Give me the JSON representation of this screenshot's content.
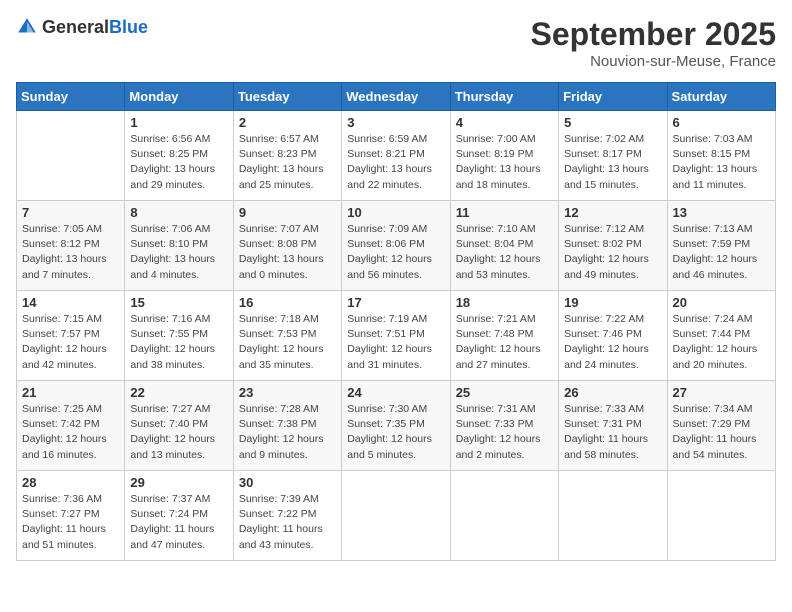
{
  "header": {
    "logo_general": "General",
    "logo_blue": "Blue",
    "month": "September 2025",
    "location": "Nouvion-sur-Meuse, France"
  },
  "days_of_week": [
    "Sunday",
    "Monday",
    "Tuesday",
    "Wednesday",
    "Thursday",
    "Friday",
    "Saturday"
  ],
  "weeks": [
    [
      {
        "day": "",
        "info": ""
      },
      {
        "day": "1",
        "info": "Sunrise: 6:56 AM\nSunset: 8:25 PM\nDaylight: 13 hours\nand 29 minutes."
      },
      {
        "day": "2",
        "info": "Sunrise: 6:57 AM\nSunset: 8:23 PM\nDaylight: 13 hours\nand 25 minutes."
      },
      {
        "day": "3",
        "info": "Sunrise: 6:59 AM\nSunset: 8:21 PM\nDaylight: 13 hours\nand 22 minutes."
      },
      {
        "day": "4",
        "info": "Sunrise: 7:00 AM\nSunset: 8:19 PM\nDaylight: 13 hours\nand 18 minutes."
      },
      {
        "day": "5",
        "info": "Sunrise: 7:02 AM\nSunset: 8:17 PM\nDaylight: 13 hours\nand 15 minutes."
      },
      {
        "day": "6",
        "info": "Sunrise: 7:03 AM\nSunset: 8:15 PM\nDaylight: 13 hours\nand 11 minutes."
      }
    ],
    [
      {
        "day": "7",
        "info": "Sunrise: 7:05 AM\nSunset: 8:12 PM\nDaylight: 13 hours\nand 7 minutes."
      },
      {
        "day": "8",
        "info": "Sunrise: 7:06 AM\nSunset: 8:10 PM\nDaylight: 13 hours\nand 4 minutes."
      },
      {
        "day": "9",
        "info": "Sunrise: 7:07 AM\nSunset: 8:08 PM\nDaylight: 13 hours\nand 0 minutes."
      },
      {
        "day": "10",
        "info": "Sunrise: 7:09 AM\nSunset: 8:06 PM\nDaylight: 12 hours\nand 56 minutes."
      },
      {
        "day": "11",
        "info": "Sunrise: 7:10 AM\nSunset: 8:04 PM\nDaylight: 12 hours\nand 53 minutes."
      },
      {
        "day": "12",
        "info": "Sunrise: 7:12 AM\nSunset: 8:02 PM\nDaylight: 12 hours\nand 49 minutes."
      },
      {
        "day": "13",
        "info": "Sunrise: 7:13 AM\nSunset: 7:59 PM\nDaylight: 12 hours\nand 46 minutes."
      }
    ],
    [
      {
        "day": "14",
        "info": "Sunrise: 7:15 AM\nSunset: 7:57 PM\nDaylight: 12 hours\nand 42 minutes."
      },
      {
        "day": "15",
        "info": "Sunrise: 7:16 AM\nSunset: 7:55 PM\nDaylight: 12 hours\nand 38 minutes."
      },
      {
        "day": "16",
        "info": "Sunrise: 7:18 AM\nSunset: 7:53 PM\nDaylight: 12 hours\nand 35 minutes."
      },
      {
        "day": "17",
        "info": "Sunrise: 7:19 AM\nSunset: 7:51 PM\nDaylight: 12 hours\nand 31 minutes."
      },
      {
        "day": "18",
        "info": "Sunrise: 7:21 AM\nSunset: 7:48 PM\nDaylight: 12 hours\nand 27 minutes."
      },
      {
        "day": "19",
        "info": "Sunrise: 7:22 AM\nSunset: 7:46 PM\nDaylight: 12 hours\nand 24 minutes."
      },
      {
        "day": "20",
        "info": "Sunrise: 7:24 AM\nSunset: 7:44 PM\nDaylight: 12 hours\nand 20 minutes."
      }
    ],
    [
      {
        "day": "21",
        "info": "Sunrise: 7:25 AM\nSunset: 7:42 PM\nDaylight: 12 hours\nand 16 minutes."
      },
      {
        "day": "22",
        "info": "Sunrise: 7:27 AM\nSunset: 7:40 PM\nDaylight: 12 hours\nand 13 minutes."
      },
      {
        "day": "23",
        "info": "Sunrise: 7:28 AM\nSunset: 7:38 PM\nDaylight: 12 hours\nand 9 minutes."
      },
      {
        "day": "24",
        "info": "Sunrise: 7:30 AM\nSunset: 7:35 PM\nDaylight: 12 hours\nand 5 minutes."
      },
      {
        "day": "25",
        "info": "Sunrise: 7:31 AM\nSunset: 7:33 PM\nDaylight: 12 hours\nand 2 minutes."
      },
      {
        "day": "26",
        "info": "Sunrise: 7:33 AM\nSunset: 7:31 PM\nDaylight: 11 hours\nand 58 minutes."
      },
      {
        "day": "27",
        "info": "Sunrise: 7:34 AM\nSunset: 7:29 PM\nDaylight: 11 hours\nand 54 minutes."
      }
    ],
    [
      {
        "day": "28",
        "info": "Sunrise: 7:36 AM\nSunset: 7:27 PM\nDaylight: 11 hours\nand 51 minutes."
      },
      {
        "day": "29",
        "info": "Sunrise: 7:37 AM\nSunset: 7:24 PM\nDaylight: 11 hours\nand 47 minutes."
      },
      {
        "day": "30",
        "info": "Sunrise: 7:39 AM\nSunset: 7:22 PM\nDaylight: 11 hours\nand 43 minutes."
      },
      {
        "day": "",
        "info": ""
      },
      {
        "day": "",
        "info": ""
      },
      {
        "day": "",
        "info": ""
      },
      {
        "day": "",
        "info": ""
      }
    ]
  ]
}
